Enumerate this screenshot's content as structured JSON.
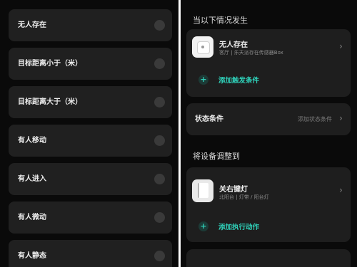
{
  "left": {
    "options": [
      {
        "label": "无人存在"
      },
      {
        "label": "目标距离小于（米）"
      },
      {
        "label": "目标距离大于（米）"
      },
      {
        "label": "有人移动"
      },
      {
        "label": "有人进入"
      },
      {
        "label": "有人微动"
      },
      {
        "label": "有人静态"
      }
    ]
  },
  "right": {
    "trigger_section_title": "当以下情况发生",
    "trigger_device": {
      "name": "无人存在",
      "subtitle": "客厅 | 乐天派存在传感器Box",
      "icon": "sensor-box-icon"
    },
    "add_trigger_label": "添加触发条件",
    "state_condition": {
      "label": "状态条件",
      "action_label": "添加状态条件"
    },
    "action_section_title": "将设备调整到",
    "action_device": {
      "name": "关右键灯",
      "subtitle": "北阳台 | 灯带 / 阳台灯",
      "icon": "wall-switch-icon"
    },
    "add_action_label": "添加执行动作"
  },
  "colors": {
    "background": "#0a0a0a",
    "card": "#1e1e1e",
    "accent": "#2fcfb8"
  }
}
